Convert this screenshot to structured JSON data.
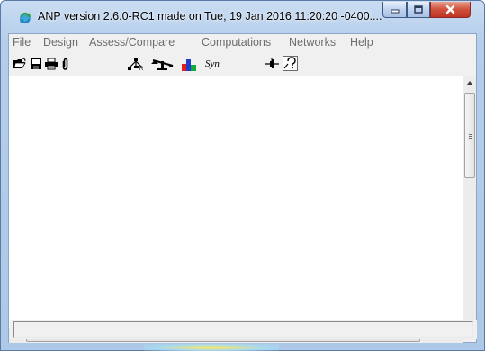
{
  "window": {
    "title": "ANP version 2.6.0-RC1 made on Tue, 19 Jan 2016 11:20:20 -0400....",
    "controls": {
      "minimize_icon": "minimize-icon",
      "maximize_icon": "maximize-icon",
      "close_icon": "close-icon",
      "close_label": "x"
    }
  },
  "menu": {
    "items": [
      {
        "label": "File"
      },
      {
        "label": "Design"
      },
      {
        "label": "Assess/Compare"
      },
      {
        "label": "Computations"
      },
      {
        "label": "Networks"
      },
      {
        "label": "Help"
      }
    ]
  },
  "toolbar": {
    "buttons": [
      {
        "icon": "open-folder-icon"
      },
      {
        "icon": "save-disk-icon"
      },
      {
        "icon": "print-icon"
      },
      {
        "icon": "paperclip-icon"
      },
      {
        "icon": "hierarchy-icon"
      },
      {
        "icon": "balance-scale-icon"
      },
      {
        "icon": "bar-chart-icon"
      },
      {
        "icon": "synthesis-icon",
        "label": "Syn"
      },
      {
        "icon": "pin-icon"
      },
      {
        "icon": "help-query-icon"
      }
    ]
  },
  "scrollbars": {
    "vertical_thumb_pos": 0.0,
    "horizontal_thumb_pos": 0.0
  },
  "status": {
    "text": ""
  },
  "colors": {
    "title_bg": "#b5cdea",
    "close_button": "#c9412d",
    "menu_text": "#6d6d6d",
    "canvas": "#ffffff"
  }
}
